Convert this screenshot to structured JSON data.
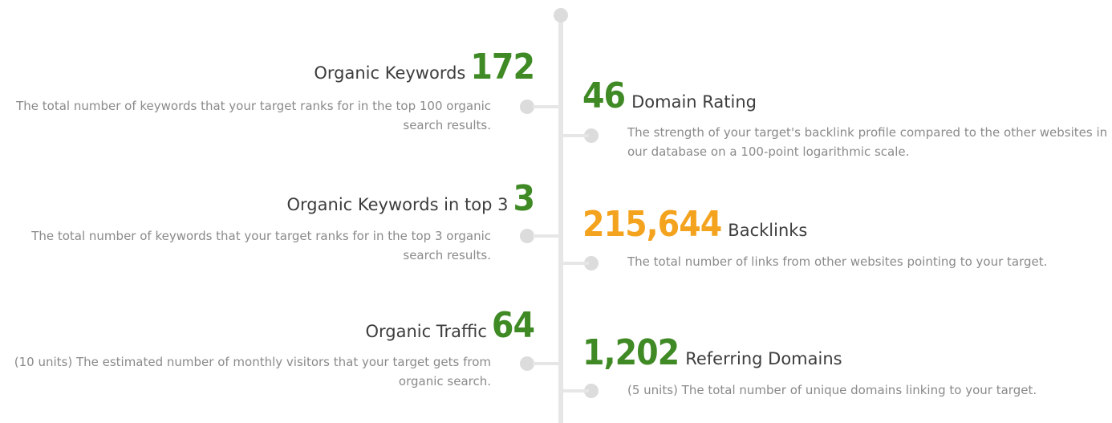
{
  "left_items": [
    {
      "label": "Organic Keywords",
      "value": "172",
      "description": "The total number of keywords that your target ranks for in the top 100 organic search results."
    },
    {
      "label": "Organic Keywords in top 3",
      "value": "3",
      "description": "The total number of keywords that your target ranks for in the top 3 organic search results."
    },
    {
      "label": "Organic Traffic",
      "value": "64",
      "description": "(10 units) The estimated number of monthly visitors that your target gets from organic search."
    }
  ],
  "right_items": [
    {
      "label": "Domain Rating",
      "value": "46",
      "description": "The strength of your target's backlink profile compared to the other websites in our database on a 100-point logarithmic scale."
    },
    {
      "label": "Backlinks",
      "value": "215,644",
      "description": "The total number of links from other websites pointing to your target."
    },
    {
      "label": "Referring Domains",
      "value": "1,202",
      "description": "(5 units) The total number of unique domains linking to your target."
    }
  ],
  "colors": {
    "green": "#3f8a25",
    "orange": "#f4a31f",
    "line": "#e6e6e6",
    "dot": "#dcdcdc",
    "label": "#3d3d3d",
    "description": "#8a8a8a"
  }
}
